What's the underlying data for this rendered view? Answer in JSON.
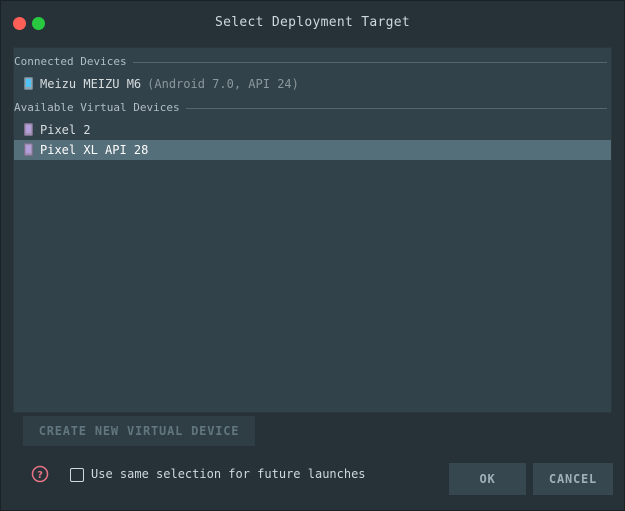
{
  "window": {
    "title": "Select Deployment Target"
  },
  "connected": {
    "header": "Connected Devices",
    "devices": [
      {
        "name": "Meizu MEIZU M6",
        "detail": "(Android 7.0, API 24)",
        "icon": "phone-icon"
      }
    ]
  },
  "virtual": {
    "header": "Available Virtual Devices",
    "devices": [
      {
        "name": "Pixel 2",
        "icon": "emulator-phone-icon"
      },
      {
        "name": "Pixel XL API 28",
        "icon": "emulator-phone-icon",
        "selected": true
      }
    ]
  },
  "buttons": {
    "create": "CREATE NEW VIRTUAL DEVICE",
    "ok": "OK",
    "cancel": "CANCEL"
  },
  "options": {
    "same_selection_label": "Use same selection for future launches",
    "same_selection_checked": false
  },
  "colors": {
    "background": "#263238",
    "panel": "#32424a",
    "selection": "#546e7a",
    "help": "#e57385"
  }
}
